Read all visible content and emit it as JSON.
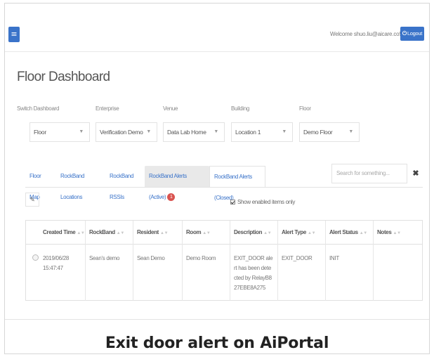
{
  "header": {
    "welcome_text": "Welcome shuo.liu@aicare.co!",
    "logout_label": "Logout",
    "logout_icon": "logout-icon",
    "menu_icon": "hamburger-menu-icon"
  },
  "page": {
    "title": "Floor Dashboard"
  },
  "filters": [
    {
      "label": "Switch Dashboard",
      "value": "Floor"
    },
    {
      "label": "Enterprise",
      "value": "Verification Demo"
    },
    {
      "label": "Venue",
      "value": "Data Lab Home"
    },
    {
      "label": "Building",
      "value": "Location 1"
    },
    {
      "label": "Floor",
      "value": "Demo Floor"
    }
  ],
  "tabs": [
    {
      "label": "Floor Map"
    },
    {
      "label": "RockBand Locations"
    },
    {
      "label": "RockBand RSSIs"
    },
    {
      "label": "RockBand Alerts (Active)",
      "badge": "1"
    },
    {
      "label": "RockBand Alerts (Closed)"
    }
  ],
  "search": {
    "placeholder": "Search for something...",
    "clear_label": "✖"
  },
  "toolbar": {
    "edit_icon": "pencil-icon",
    "show_enabled_label": "Show enabled items only",
    "show_enabled_checked": true
  },
  "table": {
    "columns": [
      "Created Time",
      "RockBand",
      "Resident",
      "Room",
      "Description",
      "Alert Type",
      "Alert Status",
      "Notes"
    ],
    "sort_glyph": "▲▼",
    "rows": [
      {
        "created_time": "2019/06/28 15:47:47",
        "rockband": "Sean's demo",
        "resident": "Sean Demo",
        "room": "Demo Room",
        "description": "EXIT_DOOR alert has been detected by RelayB827EBE8A275",
        "alert_type": "EXIT_DOOR",
        "alert_status": "INIT",
        "notes": ""
      }
    ]
  },
  "caption": "Exit door alert on AiPortal",
  "colors": {
    "primary": "#3a73c9",
    "badge": "#d9534f"
  }
}
